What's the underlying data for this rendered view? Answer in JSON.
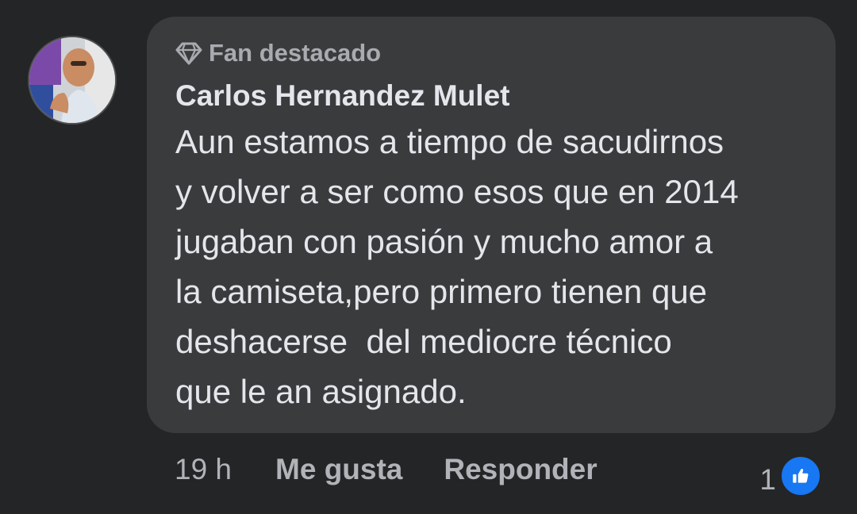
{
  "comment": {
    "badge": {
      "icon": "diamond-icon",
      "label": "Fan destacado"
    },
    "author": "Carlos Hernandez Mulet",
    "text": "Aun estamos a tiempo de sacudirnos\ny volver a ser como esos que en 2014\njugaban con pasión y mucho amor a\nla camiseta,pero primero tienen que\ndeshacerse  del mediocre técnico\nque le an asignado.",
    "actions": {
      "time": "19 h",
      "like_label": "Me gusta",
      "reply_label": "Responder"
    },
    "reactions": {
      "count": "1",
      "icon": "thumbs-up-icon",
      "color": "#1877f2"
    }
  },
  "colors": {
    "background": "#242526",
    "bubble": "#3a3b3c",
    "primary_text": "#e4e6eb",
    "secondary_text": "#b0b3b8"
  }
}
